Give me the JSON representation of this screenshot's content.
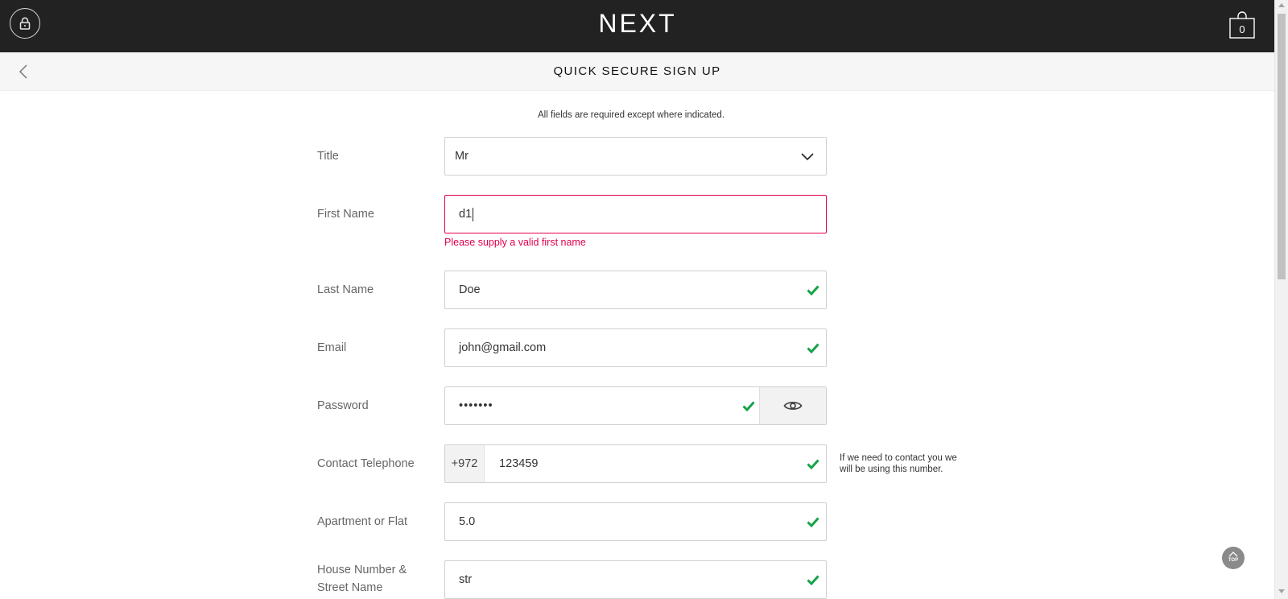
{
  "header": {
    "brand": "NEXT",
    "bag_count": "0"
  },
  "subheader": {
    "title": "QUICK SECURE SIGN UP"
  },
  "form": {
    "intro": "All fields are required except where indicated.",
    "title": {
      "label": "Title",
      "value": "Mr"
    },
    "first_name": {
      "label": "First Name",
      "value": "d1",
      "error": "Please supply a valid first name"
    },
    "last_name": {
      "label": "Last Name",
      "value": "Doe"
    },
    "email": {
      "label": "Email",
      "value": "john@gmail.com"
    },
    "password": {
      "label": "Password",
      "value": "•••••••"
    },
    "telephone": {
      "label": "Contact Telephone",
      "dial_code": "+972",
      "value": "123459",
      "hint": "If we need to contact you we will be using this number."
    },
    "apartment": {
      "label": "Apartment or Flat",
      "value": "5.0"
    },
    "street": {
      "label": "House Number & Street Name",
      "value": "str"
    }
  },
  "scroll_top": {
    "label": "TOP"
  },
  "colors": {
    "header_bg": "#222222",
    "error": "#e4004b",
    "valid": "#17a34a"
  },
  "icons": [
    "lock-icon",
    "bag-icon",
    "back-chevron-icon",
    "chevron-down-icon",
    "checkmark-icon",
    "eye-icon",
    "arrow-up-icon"
  ]
}
